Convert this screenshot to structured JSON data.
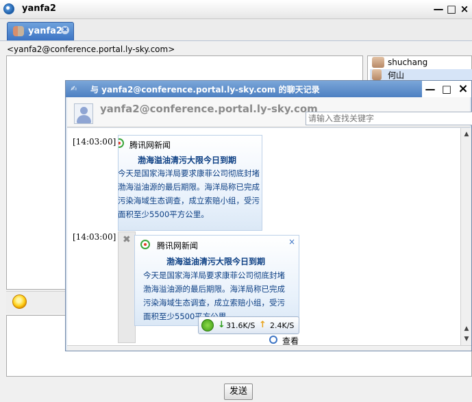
{
  "window": {
    "title": "yanfa2",
    "buttons": {
      "close": "×",
      "maximize": "□",
      "minimize": "—"
    }
  },
  "tabs": [
    {
      "label": "yanfa2",
      "close": "✖"
    }
  ],
  "room": {
    "address": "<yanfa2@conference.portal.ly-sky.com>"
  },
  "members": [
    {
      "name": "shuchang"
    },
    {
      "name": "何山"
    }
  ],
  "input": {
    "send_label": "发送"
  },
  "history": {
    "title": "与 yanfa2@conference.portal.ly-sky.com 的聊天记录",
    "room_name": "yanfa2@conference.portal.ly-sky.com",
    "search_placeholder": "请输入查找关键字",
    "messages": [
      {
        "timestamp": "[14:03:00]",
        "card": {
          "source": "腾讯网新闻",
          "headline": "渤海溢油清污大限今日到期",
          "body": [
            "今天是国家海洋局要求康菲公司彻底封堵",
            "渤海溢油源的最后期限。海洋局称已完成",
            "污染海域生态调查，成立索赔小组，受污",
            "面积至少5500平方公里。"
          ]
        }
      },
      {
        "timestamp": "[14:03:00]",
        "card": {
          "source": "腾讯网新闻",
          "headline": "渤海溢油清污大限今日到期",
          "body": [
            "今天是国家海洋局要求康菲公司彻底封堵",
            "渤海溢油源的最后期限。海洋局称已完成",
            "污染海域生态调查，成立索赔小组，受污",
            "面积至少5500平方公里。"
          ],
          "close": "×"
        }
      }
    ],
    "speed": {
      "down": "31.6K/S",
      "up": "2.4K/S"
    },
    "view_label": "查看"
  }
}
